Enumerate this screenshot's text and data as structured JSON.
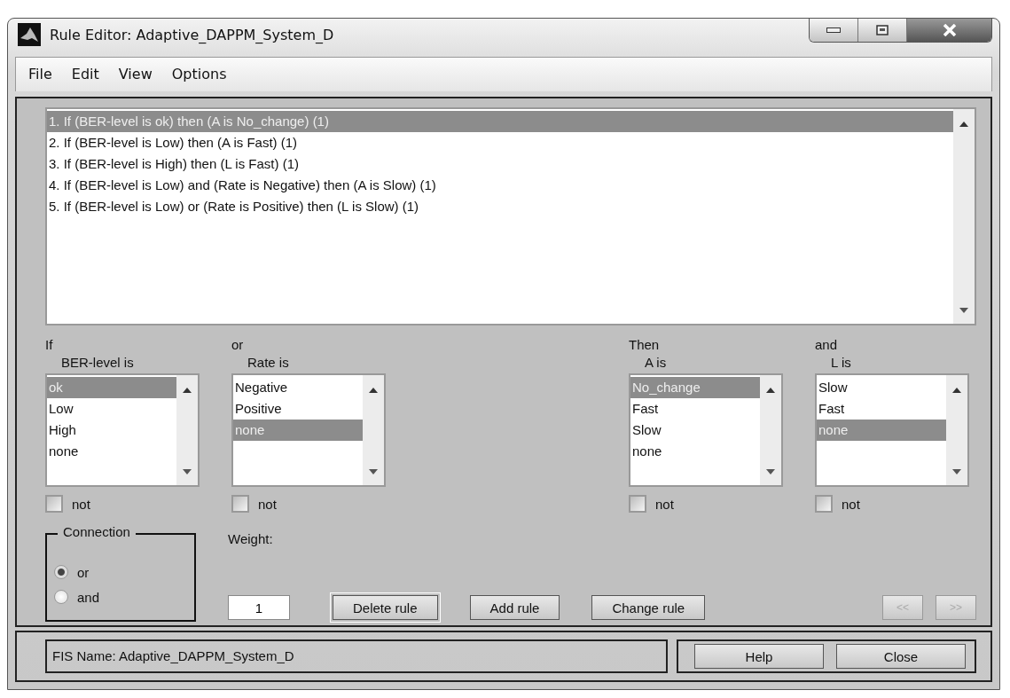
{
  "window": {
    "title": "Rule Editor: Adaptive_DAPPM_System_D"
  },
  "menu": [
    "File",
    "Edit",
    "View",
    "Options"
  ],
  "rules": [
    {
      "text": "1. If (BER-level is ok) then (A is No_change) (1)",
      "selected": true
    },
    {
      "text": "2. If (BER-level is Low) then (A is Fast) (1)",
      "selected": false
    },
    {
      "text": "3. If (BER-level is High) then (L is Fast) (1)",
      "selected": false
    },
    {
      "text": "4. If (BER-level is Low) and (Rate is Negative) then (A is Slow) (1)",
      "selected": false
    },
    {
      "text": "5. If (BER-level is Low) or (Rate is Positive) then (L is Slow) (1)",
      "selected": false
    }
  ],
  "inputs": [
    {
      "prefix": "If",
      "label": "BER-level is",
      "items": [
        {
          "text": "ok",
          "selected": true
        },
        {
          "text": "Low",
          "selected": false
        },
        {
          "text": "High",
          "selected": false
        },
        {
          "text": "none",
          "selected": false
        }
      ],
      "not": {
        "label": "not",
        "checked": false
      }
    },
    {
      "prefix": "or",
      "label": "Rate is",
      "items": [
        {
          "text": "Negative",
          "selected": false
        },
        {
          "text": "Positive",
          "selected": false
        },
        {
          "text": "none",
          "selected": true
        }
      ],
      "not": {
        "label": "not",
        "checked": false
      }
    }
  ],
  "outputs": [
    {
      "prefix": "Then",
      "label": "A is",
      "items": [
        {
          "text": "No_change",
          "selected": true
        },
        {
          "text": "Fast",
          "selected": false
        },
        {
          "text": "Slow",
          "selected": false
        },
        {
          "text": "none",
          "selected": false
        }
      ],
      "not": {
        "label": "not",
        "checked": false
      }
    },
    {
      "prefix": "and",
      "label": "L is",
      "items": [
        {
          "text": "Slow",
          "selected": false
        },
        {
          "text": "Fast",
          "selected": false
        },
        {
          "text": "none",
          "selected": true
        }
      ],
      "not": {
        "label": "not",
        "checked": false
      }
    }
  ],
  "connection": {
    "title": "Connection",
    "options": [
      {
        "label": "or",
        "selected": true
      },
      {
        "label": "and",
        "selected": false
      }
    ]
  },
  "weight": {
    "label": "Weight:",
    "value": "1"
  },
  "actions": [
    "Delete rule",
    "Add rule",
    "Change rule"
  ],
  "nav": [
    {
      "label": "<<",
      "disabled": true
    },
    {
      "label": ">>",
      "disabled": true
    }
  ],
  "status": "FIS Name: Adaptive_DAPPM_System_D",
  "footer_buttons": [
    "Help",
    "Close"
  ]
}
